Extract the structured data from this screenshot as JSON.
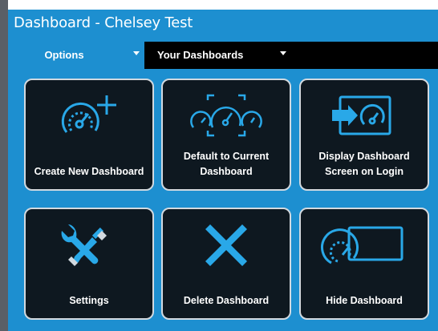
{
  "window": {
    "title": "Dashboard - Chelsey Test"
  },
  "tabs": [
    {
      "label": "Options",
      "active": true
    },
    {
      "label": "Your Dashboards",
      "active": false
    }
  ],
  "tiles": [
    {
      "label": "Create New Dashboard",
      "icon": "gauge-plus-icon"
    },
    {
      "label": "Default to Current Dashboard",
      "icon": "multi-gauge-focus-icon"
    },
    {
      "label": "Display Dashboard Screen on Login",
      "icon": "screen-login-gauge-icon"
    },
    {
      "label": "Settings",
      "icon": "wrench-screwdriver-icon"
    },
    {
      "label": "Delete Dashboard",
      "icon": "x-icon"
    },
    {
      "label": "Hide Dashboard",
      "icon": "hide-gauge-screen-icon"
    }
  ],
  "colors": {
    "accent": "#1d8fd0",
    "tile_bg": "#0e1820",
    "tile_border": "#d2d9df",
    "icon": "#29a8e8"
  }
}
